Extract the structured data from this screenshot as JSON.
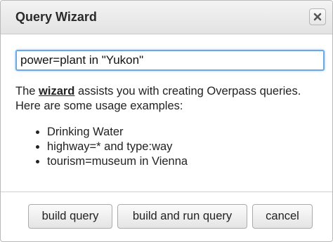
{
  "dialog": {
    "title": "Query Wizard",
    "close_icon": "close-x-icon"
  },
  "query": {
    "value": "power=plant in \"Yukon\""
  },
  "description": {
    "prefix": "The ",
    "link": "wizard",
    "suffix": " assists you with creating Overpass queries. Here are some usage examples:"
  },
  "examples": [
    "Drinking Water",
    "highway=* and type:way",
    "tourism=museum in Vienna"
  ],
  "buttons": {
    "build": "build query",
    "build_run": "build and run query",
    "cancel": "cancel"
  }
}
